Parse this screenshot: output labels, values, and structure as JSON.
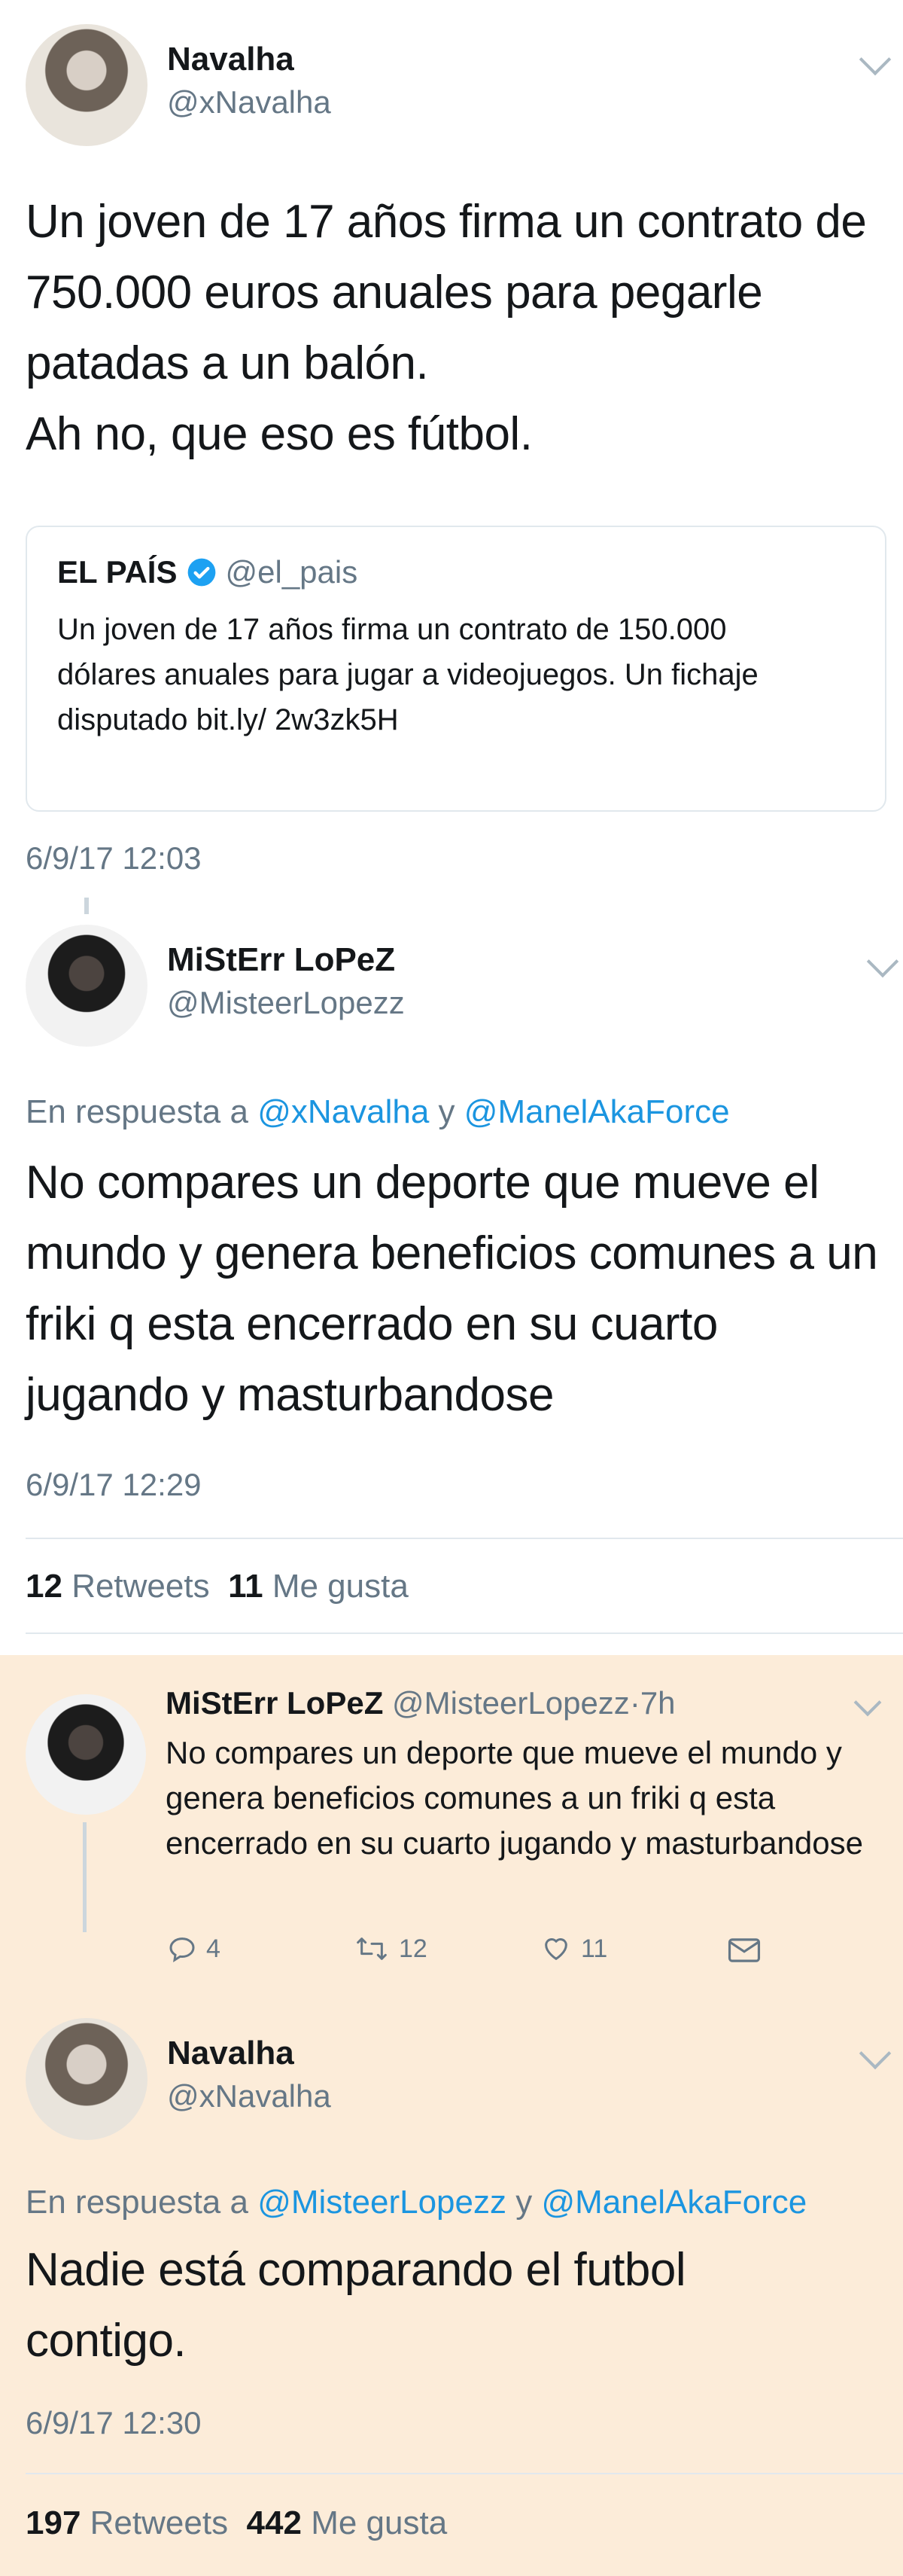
{
  "tweet1": {
    "name": "Navalha",
    "handle": "@xNavalha",
    "text": "Un joven de 17 años firma un contrato de 750.000 euros anuales para pegarle patadas a un balón.",
    "text2": "Ah no, que eso es fútbol.",
    "quote": {
      "name": "EL PAÍS",
      "handle": "@el_pais",
      "text": "Un joven de 17 años firma un contrato de 150.000 dólares anuales para jugar a videojuegos. Un fichaje disputado bit.ly/ 2w3zk5H"
    },
    "time": "6/9/17 12:03"
  },
  "tweet2": {
    "name": "MiStErr LoPeZ",
    "handle": "@MisteerLopezz",
    "reply_prefix": "En respuesta a",
    "reply_to1": "@xNavalha",
    "reply_and": "y",
    "reply_to2": "@ManelAkaForce",
    "text": "No compares un deporte que mueve el mundo y genera beneficios comunes a un friki q esta encerrado en su cuarto jugando y masturbandose",
    "time": "6/9/17 12:29",
    "retweets": "12",
    "retweets_label": "Retweets",
    "likes": "11",
    "likes_label": "Me gusta"
  },
  "tweet3": {
    "name": "MiStErr LoPeZ",
    "handle": "@MisteerLopezz",
    "dot": "·",
    "age": "7h",
    "text": "No compares un deporte que mueve el mundo y genera beneficios comunes a un friki q esta encerrado en su cuarto jugando y masturbandose",
    "replies": "4",
    "retweets": "12",
    "likes": "11"
  },
  "tweet4": {
    "name": "Navalha",
    "handle": "@xNavalha",
    "reply_prefix": "En respuesta a",
    "reply_to1": "@MisteerLopezz",
    "reply_and": "y",
    "reply_to2": "@ManelAkaForce",
    "text": "Nadie está comparando el futbol contigo.",
    "time": "6/9/17 12:30",
    "retweets": "197",
    "retweets_label": "Retweets",
    "likes": "442",
    "likes_label": "Me gusta"
  },
  "colors": {
    "link": "#1b95e0",
    "muted": "#657786",
    "highlight_bg": "#fcecd9",
    "verified": "#1da1f2"
  },
  "icons": [
    "chevron-down-icon",
    "verified-badge-icon",
    "reply-icon",
    "retweet-icon",
    "heart-icon",
    "message-icon"
  ]
}
